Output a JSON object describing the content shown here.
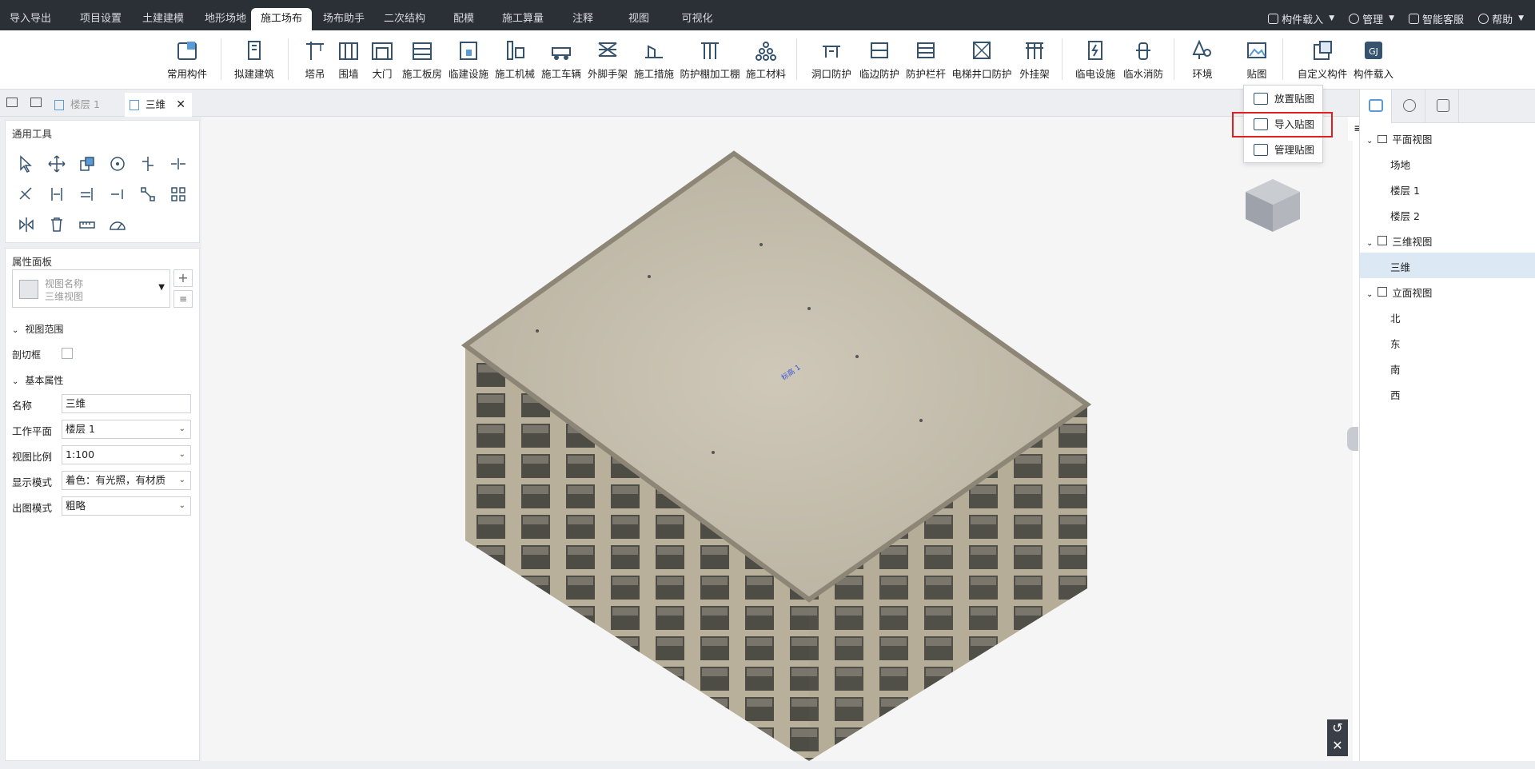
{
  "top_tabs": [
    "导入导出",
    "项目设置",
    "土建建模",
    "地形场地",
    "施工场布",
    "场布助手",
    "二次结构",
    "配模",
    "施工算量",
    "注释",
    "视图",
    "可视化"
  ],
  "active_tab": "施工场布",
  "top_right": {
    "component_load": "构件载入",
    "manage": "管理",
    "service": "智能客服",
    "help": "帮助"
  },
  "ribbon": [
    "常用构件",
    "拟建建筑",
    "塔吊",
    "围墙",
    "大门",
    "施工板房",
    "临建设施",
    "施工机械",
    "施工车辆",
    "外脚手架",
    "施工措施",
    "防护棚加工棚",
    "施工材料",
    "洞口防护",
    "临边防护",
    "防护栏杆",
    "电梯井口防护",
    "外挂架",
    "临电设施",
    "临水消防",
    "环境",
    "贴图",
    "自定义构件",
    "构件载入"
  ],
  "view_tabs": {
    "floor": "楼层 1",
    "active": "三维"
  },
  "left": {
    "common_tools_title": "通用工具",
    "property_panel_title": "属性面板",
    "view_name_label": "视图名称",
    "view_name_value": "三维视图",
    "view_range": "视图范围",
    "section_box": "剖切框",
    "basic_props": "基本属性",
    "props": [
      {
        "label": "名称",
        "value": "三维",
        "dropdown": false
      },
      {
        "label": "工作平面",
        "value": "楼层 1",
        "dropdown": true
      },
      {
        "label": "视图比例",
        "value": "1:100",
        "dropdown": true
      },
      {
        "label": "显示模式",
        "value": "着色：有光照，有材质",
        "dropdown": true
      },
      {
        "label": "出图模式",
        "value": "粗略",
        "dropdown": true
      }
    ]
  },
  "dropdown": {
    "items": [
      "放置贴图",
      "导入贴图",
      "管理贴图"
    ],
    "highlighted": "导入贴图",
    "highlight_color": "#e02020"
  },
  "right_tree": {
    "plan_view": "平面视图",
    "plan_items": [
      "场地",
      "楼层 1",
      "楼层 2"
    ],
    "view3d": "三维视图",
    "view3d_items": [
      "三维"
    ],
    "elevation": "立面视图",
    "elevation_items": [
      "北",
      "东",
      "南",
      "西"
    ]
  },
  "canvas_label": "标高 1"
}
